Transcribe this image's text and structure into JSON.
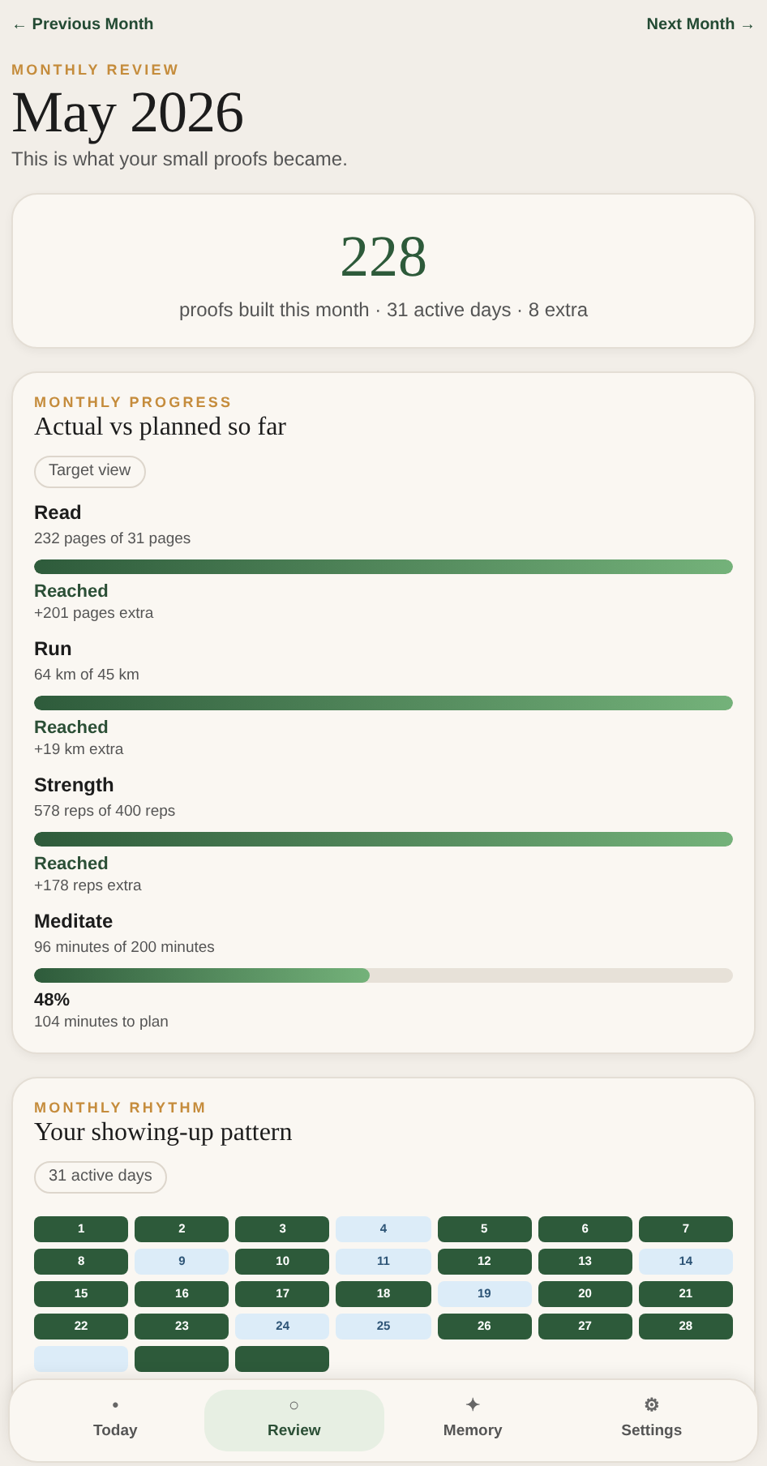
{
  "top_nav": {
    "previous": "← Previous Month",
    "next": "Next Month →"
  },
  "header": {
    "eyebrow": "MONTHLY REVIEW",
    "title": "May 2026",
    "subtitle": "This is what your small proofs became."
  },
  "summary": {
    "total": "228",
    "caption": "proofs built this month · 31 active days · 8 extra"
  },
  "progress": {
    "eyebrow": "MONTHLY PROGRESS",
    "title": "Actual vs planned so far",
    "chip": "Target view",
    "goals": [
      {
        "name": "Read",
        "detail": "232 pages of 31 pages",
        "level": 1,
        "reached": true,
        "status": "Reached",
        "note": "+201 pages extra"
      },
      {
        "name": "Run",
        "detail": "64 km of 45 km",
        "level": 1,
        "reached": true,
        "status": "Reached",
        "note": "+19 km extra"
      },
      {
        "name": "Strength",
        "detail": "578 reps of 400 reps",
        "level": 1,
        "reached": true,
        "status": "Reached",
        "note": "+178 reps extra"
      },
      {
        "name": "Meditate",
        "detail": "96 minutes of 200 minutes",
        "level": 0.48,
        "reached": false,
        "status": "48%",
        "note": "104 minutes to plan"
      }
    ]
  },
  "rhythm": {
    "eyebrow": "MONTHLY RHYTHM",
    "title": "Your showing-up pattern",
    "chip": "31 active days",
    "days": [
      {
        "label": "1",
        "active": true
      },
      {
        "label": "2",
        "active": true
      },
      {
        "label": "3",
        "active": true
      },
      {
        "label": "4",
        "active": false
      },
      {
        "label": "5",
        "active": true
      },
      {
        "label": "6",
        "active": true
      },
      {
        "label": "7",
        "active": true
      },
      {
        "label": "8",
        "active": true
      },
      {
        "label": "9",
        "active": false
      },
      {
        "label": "10",
        "active": true
      },
      {
        "label": "11",
        "active": false
      },
      {
        "label": "12",
        "active": true
      },
      {
        "label": "13",
        "active": true
      },
      {
        "label": "14",
        "active": false
      },
      {
        "label": "15",
        "active": true
      },
      {
        "label": "16",
        "active": true
      },
      {
        "label": "17",
        "active": true
      },
      {
        "label": "18",
        "active": true
      },
      {
        "label": "19",
        "active": false
      },
      {
        "label": "20",
        "active": true
      },
      {
        "label": "21",
        "active": true
      },
      {
        "label": "22",
        "active": true
      },
      {
        "label": "23",
        "active": true
      },
      {
        "label": "24",
        "active": false
      },
      {
        "label": "25",
        "active": false
      },
      {
        "label": "26",
        "active": true
      },
      {
        "label": "27",
        "active": true
      },
      {
        "label": "28",
        "active": true
      },
      {
        "active": false
      },
      {
        "active": true
      },
      {
        "active": true
      }
    ]
  },
  "bottom_nav": [
    {
      "icon": "•",
      "label": "Today",
      "selected": false
    },
    {
      "icon": "○",
      "label": "Review",
      "selected": true
    },
    {
      "icon": "✦",
      "label": "Memory",
      "selected": false
    },
    {
      "icon": "⚙",
      "label": "Settings",
      "selected": false
    }
  ]
}
